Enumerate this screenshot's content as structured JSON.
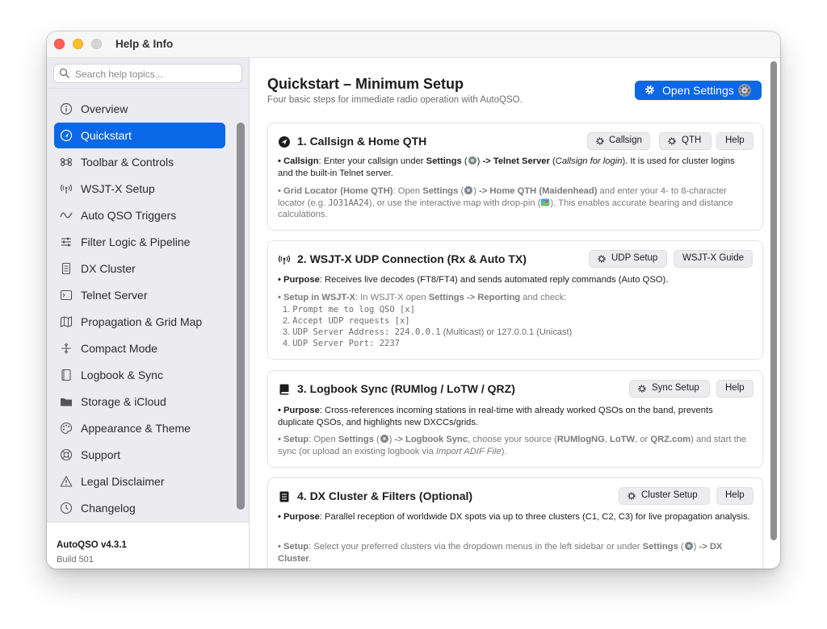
{
  "window": {
    "title": "Help & Info"
  },
  "sidebar": {
    "search_placeholder": "Search help topics...",
    "items": [
      {
        "label": "Overview",
        "icon": "info-icon"
      },
      {
        "label": "Quickstart",
        "icon": "navigation-arrow-icon",
        "active": true
      },
      {
        "label": "Toolbar & Controls",
        "icon": "command-icon"
      },
      {
        "label": "WSJT-X Setup",
        "icon": "antenna-icon"
      },
      {
        "label": "Auto QSO Triggers",
        "icon": "waveform-icon"
      },
      {
        "label": "Filter Logic & Pipeline",
        "icon": "sliders-icon"
      },
      {
        "label": "DX Cluster",
        "icon": "document-icon"
      },
      {
        "label": "Telnet Server",
        "icon": "terminal-icon"
      },
      {
        "label": "Propagation & Grid Map",
        "icon": "map-icon"
      },
      {
        "label": "Compact Mode",
        "icon": "compress-icon"
      },
      {
        "label": "Logbook & Sync",
        "icon": "book-icon"
      },
      {
        "label": "Storage & iCloud",
        "icon": "folder-icon"
      },
      {
        "label": "Appearance & Theme",
        "icon": "palette-icon"
      },
      {
        "label": "Support",
        "icon": "lifebuoy-icon"
      },
      {
        "label": "Legal Disclaimer",
        "icon": "warning-icon"
      },
      {
        "label": "Changelog",
        "icon": "clock-icon"
      }
    ],
    "footer": {
      "app_name": "AutoQSO v4.3.1",
      "build": "Build 501"
    }
  },
  "main": {
    "title": "Quickstart – Minimum Setup",
    "subtitle": "Four basic steps for immediate radio operation with AutoQSO.",
    "open_settings_label": "Open Settings",
    "cards": [
      {
        "title": "1. Callsign & Home QTH",
        "buttons": [
          "Callsign",
          "QTH",
          "Help"
        ],
        "p1": {
          "bullet": "• ",
          "label": "Callsign",
          "t1": ": Enter your callsign under ",
          "b1": "Settings",
          "t2": " (",
          "t3": ") ",
          "b2": "-> Telnet Server",
          "t4": " (",
          "i1": "Callsign for login",
          "t5": "). It is used for cluster logins and the built-in Telnet server."
        },
        "p2": {
          "bullet": "• ",
          "label": "Grid Locator (Home QTH)",
          "t1": ": Open ",
          "b1": "Settings",
          "t2": " (",
          "t3": ") ",
          "b2": "-> Home QTH (Maidenhead)",
          "t4": " and enter your 4- to 8-character locator (e.g. ",
          "code": "JO31AA24",
          "t5": "), or use the interactive map with drop-pin (",
          "t6": "). This enables accurate bearing and distance calculations."
        }
      },
      {
        "title": "2. WSJT-X UDP Connection (Rx & Auto TX)",
        "buttons": [
          "UDP Setup",
          "WSJT-X Guide"
        ],
        "p1": {
          "bullet": "• ",
          "label": "Purpose",
          "text": ": Receives live decodes (FT8/FT4) and sends automated reply commands (Auto QSO)."
        },
        "p2": {
          "bullet": "• ",
          "label": "Setup in WSJT-X",
          "t1": ": In WSJT-X open ",
          "b1": "Settings -> Reporting",
          "t2": " and check:"
        },
        "steps": [
          {
            "num": "1. ",
            "mono": "Prompt me to log QSO [x]",
            "rest": ""
          },
          {
            "num": "2. ",
            "mono": "Accept UDP requests [x]",
            "rest": ""
          },
          {
            "num": "3. ",
            "mono": "UDP Server Address: 224.0.0.1",
            "rest": " (Multicast) or 127.0.0.1 (Unicast)"
          },
          {
            "num": "4. ",
            "mono": "UDP Server Port: 2237",
            "rest": ""
          }
        ]
      },
      {
        "title": "3. Logbook Sync (RUMlog / LoTW / QRZ)",
        "buttons": [
          "Sync Setup",
          "Help"
        ],
        "p1": {
          "bullet": "• ",
          "label": "Purpose",
          "text": ": Cross-references incoming stations in real-time with already worked QSOs on the band, prevents duplicate QSOs, and highlights new DXCCs/grids."
        },
        "p2": {
          "bullet": "• ",
          "label": "Setup",
          "t1": ": Open ",
          "b1": "Settings",
          "t2": " (",
          "t3": ") ",
          "b2": "-> Logbook Sync",
          "t4": ", choose your source (",
          "s1": "RUMlogNG",
          "t5": ", ",
          "s2": "LoTW",
          "t6": ", or ",
          "s3": "QRZ.com",
          "t7": ") and start the sync (or upload an existing logbook via ",
          "i1": "Import ADIF File",
          "t8": ")."
        }
      },
      {
        "title": "4. DX Cluster & Filters (Optional)",
        "buttons": [
          "Cluster Setup",
          "Help"
        ],
        "p1": {
          "bullet": "• ",
          "label": "Purpose",
          "text": ": Parallel reception of worldwide DX spots via up to three clusters (C1, C2, C3) for live propagation analysis."
        },
        "p2": {
          "bullet": "• ",
          "label": "Setup",
          "t1": ": Select your preferred clusters via the dropdown menus in the left sidebar or under ",
          "b1": "Settings",
          "t2": " (",
          "t3": ") ",
          "b2": "-> DX Cluster",
          "t4": "."
        }
      }
    ]
  },
  "colors": {
    "accent": "#0a67e6",
    "sidebar_bg": "#ececf0",
    "muted_text": "#7a7a7e"
  }
}
